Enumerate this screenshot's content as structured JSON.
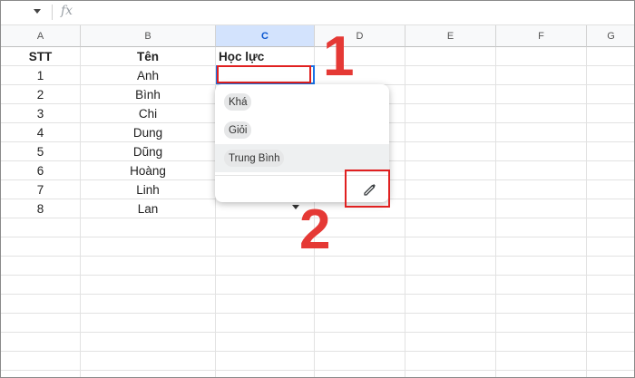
{
  "formula_bar": {
    "fx_label": "fx"
  },
  "columns": [
    "A",
    "B",
    "C",
    "D",
    "E",
    "F",
    "G"
  ],
  "selected_column": "C",
  "header_row": {
    "a": "STT",
    "b": "Tên",
    "c": "Học lực"
  },
  "rows": [
    {
      "stt": "1",
      "ten": "Anh"
    },
    {
      "stt": "2",
      "ten": "Bình"
    },
    {
      "stt": "3",
      "ten": "Chi"
    },
    {
      "stt": "4",
      "ten": "Dung"
    },
    {
      "stt": "5",
      "ten": "Dũng"
    },
    {
      "stt": "6",
      "ten": "Hoàng"
    },
    {
      "stt": "7",
      "ten": "Linh"
    },
    {
      "stt": "8",
      "ten": "Lan"
    }
  ],
  "dropdown": {
    "options": [
      "Khá",
      "Giỏi",
      "Trung Bình"
    ],
    "highlighted_index": 2,
    "edit_icon": "pencil-icon"
  },
  "annotations": {
    "step1": "1",
    "step2": "2",
    "color": "#e53935"
  }
}
